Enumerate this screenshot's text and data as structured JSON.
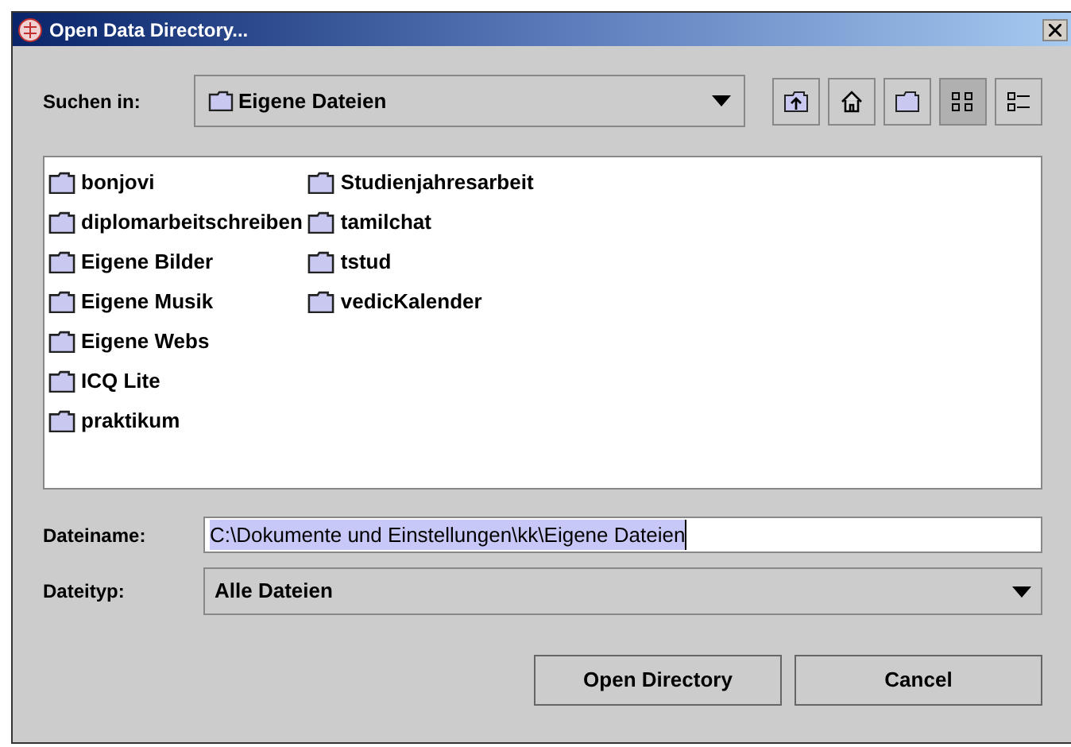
{
  "window": {
    "title": "Open Data Directory..."
  },
  "look_in": {
    "label": "Suchen in:",
    "value": "Eigene Dateien"
  },
  "toolbar": [
    {
      "kind": "up",
      "selected": false
    },
    {
      "kind": "home",
      "selected": false
    },
    {
      "kind": "new-folder",
      "selected": false
    },
    {
      "kind": "list",
      "selected": true
    },
    {
      "kind": "details",
      "selected": false
    }
  ],
  "files": [
    {
      "name": "bonjovi"
    },
    {
      "name": "diplomarbeitschreiben"
    },
    {
      "name": "Eigene Bilder"
    },
    {
      "name": "Eigene Musik"
    },
    {
      "name": "Eigene Webs"
    },
    {
      "name": "ICQ Lite"
    },
    {
      "name": "praktikum"
    },
    {
      "name": "Studienjahresarbeit"
    },
    {
      "name": "tamilchat"
    },
    {
      "name": "tstud"
    },
    {
      "name": "vedicKalender"
    }
  ],
  "file_name": {
    "label": "Dateiname:",
    "value": "C:\\Dokumente und Einstellungen\\kk\\Eigene Dateien",
    "selected": true
  },
  "file_type": {
    "label": "Dateityp:",
    "value": "Alle Dateien"
  },
  "buttons": [
    "Open Directory",
    "Cancel"
  ]
}
